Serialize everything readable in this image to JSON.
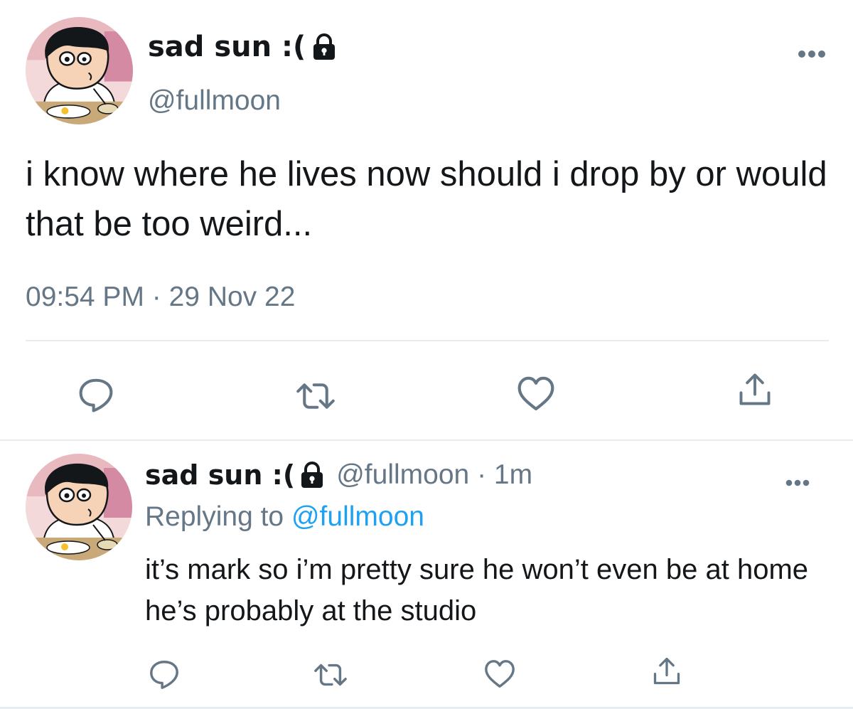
{
  "main_tweet": {
    "display_name": "sad sun :(",
    "handle": "@fullmoon",
    "more_icon": "ellipsis-icon",
    "text": "i know where he lives now should i drop by or would that be too weird...",
    "time": "09:54 PM",
    "separator": " · ",
    "date": "29 Nov 22",
    "actions": [
      "reply-icon",
      "retweet-icon",
      "like-icon",
      "share-icon"
    ]
  },
  "reply_tweet": {
    "display_name": "sad sun :(",
    "handle": "@fullmoon",
    "separator": " · ",
    "age": "1m",
    "more_icon": "ellipsis-icon",
    "replying_label": "Replying to ",
    "replying_to": "@fullmoon",
    "text": "it’s mark so i’m pretty sure he won’t even be at home he’s probably at the studio",
    "actions": [
      "reply-icon",
      "retweet-icon",
      "like-icon",
      "share-icon"
    ]
  },
  "colors": {
    "text": "#14171a",
    "secondary": "#657786",
    "link": "#1da1f2",
    "divider": "#e6ecf0"
  }
}
